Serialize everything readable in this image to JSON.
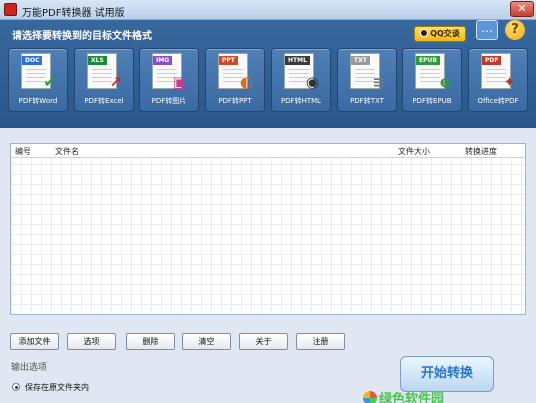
{
  "window": {
    "title": "万能PDF转换器 试用版",
    "close_glyph": "✕"
  },
  "header": {
    "title": "请选择要转换到的目标文件格式",
    "qq_label": "QQ交谈",
    "chat_glyph": "…",
    "help_glyph": "?"
  },
  "converters": [
    {
      "tag": "DOC",
      "label": "PDF转Word",
      "color": "#2f6fd6",
      "mark": "✔",
      "mark_color": "#2ca02c",
      "icon": "word-doc-icon"
    },
    {
      "tag": "XLS",
      "label": "PDF转Excel",
      "color": "#1d8a3a",
      "mark": "↗",
      "mark_color": "#d0262a",
      "icon": "excel-doc-icon"
    },
    {
      "tag": "IMG",
      "label": "PDF转图片",
      "color": "#8a4fc7",
      "mark": "▣",
      "mark_color": "#c53b8f",
      "icon": "image-doc-icon"
    },
    {
      "tag": "PPT",
      "label": "PDF转PPT",
      "color": "#d04a2a",
      "mark": "◐",
      "mark_color": "#e06b1e",
      "icon": "ppt-doc-icon"
    },
    {
      "tag": "HTML",
      "label": "PDF转HTML",
      "color": "#3b3b3b",
      "mark": "◉",
      "mark_color": "#333333",
      "icon": "html-doc-icon"
    },
    {
      "tag": "TXT",
      "label": "PDF转TXT",
      "color": "#9a9a9a",
      "mark": "≡",
      "mark_color": "#777777",
      "icon": "txt-doc-icon"
    },
    {
      "tag": "EPUB",
      "label": "PDF转EPUB",
      "color": "#2e9c3c",
      "mark": "e",
      "mark_color": "#2e9c3c",
      "icon": "epub-doc-icon"
    },
    {
      "tag": "PDF",
      "label": "Office转PDF",
      "color": "#c0392b",
      "mark": "✦",
      "mark_color": "#b03a2e",
      "icon": "office-pdf-icon"
    }
  ],
  "file_list": {
    "columns": [
      "编号",
      "文件名",
      "文件大小",
      "转换进度"
    ],
    "rows": []
  },
  "buttons": {
    "add": "添加文件",
    "options": "选项",
    "delete": "删除",
    "clear": "清空",
    "about": "关于",
    "register": "注册"
  },
  "output": {
    "label": "输出选项",
    "radio_label": "保存在原文件夹内",
    "radio_checked": true
  },
  "start_button": "开始转换",
  "watermark": "绿色软件园"
}
